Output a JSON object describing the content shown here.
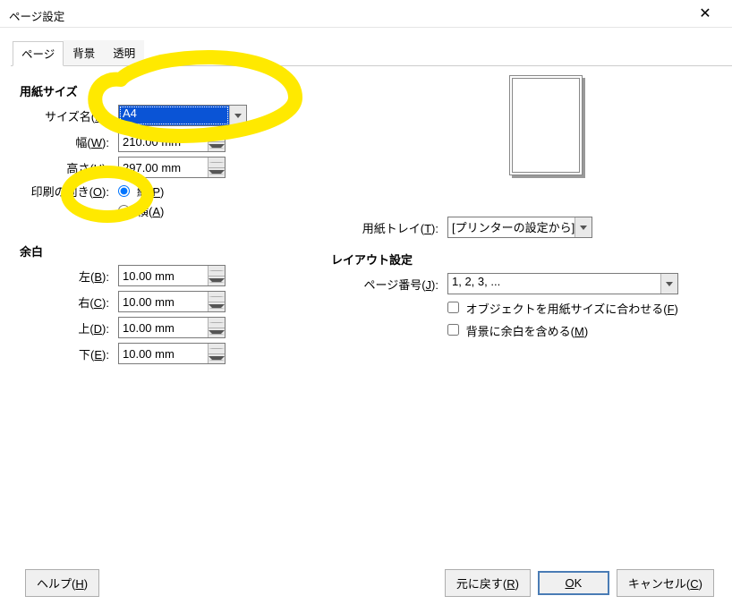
{
  "window": {
    "title": "ページ設定"
  },
  "tabs": [
    "ページ",
    "背景",
    "透明"
  ],
  "active_tab": 0,
  "paper_size": {
    "section": "用紙サイズ",
    "name_label": "サイズ名(",
    "name_accel": "F",
    "name_after": "):",
    "name_value": "A4",
    "width_label": "幅(",
    "width_accel": "W",
    "width_after": "):",
    "width_value": "210.00 mm",
    "height_label": "高さ(",
    "height_accel": "H",
    "height_after": "):",
    "height_value": "297.00 mm",
    "orient_label": "印刷の向き(",
    "orient_accel": "O",
    "orient_after": "):",
    "orient_portrait_label": "縦(",
    "orient_portrait_accel": "P",
    "orient_portrait_after": ")",
    "orient_landscape_label": "横(",
    "orient_landscape_accel": "A",
    "orient_landscape_after": ")",
    "orient_value": "portrait"
  },
  "tray": {
    "label": "用紙トレイ(",
    "accel": "T",
    "after": "):",
    "value": "[プリンターの設定から]"
  },
  "margins": {
    "section": "余白",
    "left_label": "左(",
    "left_accel": "B",
    "left_after": "):",
    "left_value": "10.00 mm",
    "right_label": "右(",
    "right_accel": "C",
    "right_after": "):",
    "right_value": "10.00 mm",
    "top_label": "上(",
    "top_accel": "D",
    "top_after": "):",
    "top_value": "10.00 mm",
    "bottom_label": "下(",
    "bottom_accel": "E",
    "bottom_after": "):",
    "bottom_value": "10.00 mm"
  },
  "layout": {
    "section": "レイアウト設定",
    "pagenum_label": "ページ番号(",
    "pagenum_accel": "J",
    "pagenum_after": "):",
    "pagenum_value": "1, 2, 3, ...",
    "fit_label": "オブジェクトを用紙サイズに合わせる(",
    "fit_accel": "F",
    "fit_after": ")",
    "fit_checked": false,
    "bgmargin_label": "背景に余白を含める(",
    "bgmargin_accel": "M",
    "bgmargin_after": ")",
    "bgmargin_checked": false
  },
  "buttons": {
    "help": "ヘルプ(",
    "help_accel": "H",
    "help_after": ")",
    "reset": "元に戻す(",
    "reset_accel": "R",
    "reset_after": ")",
    "ok_pre": "",
    "ok_accel": "O",
    "ok_mid": "K",
    "cancel": "キャンセル(",
    "cancel_accel": "C",
    "cancel_after": ")"
  }
}
